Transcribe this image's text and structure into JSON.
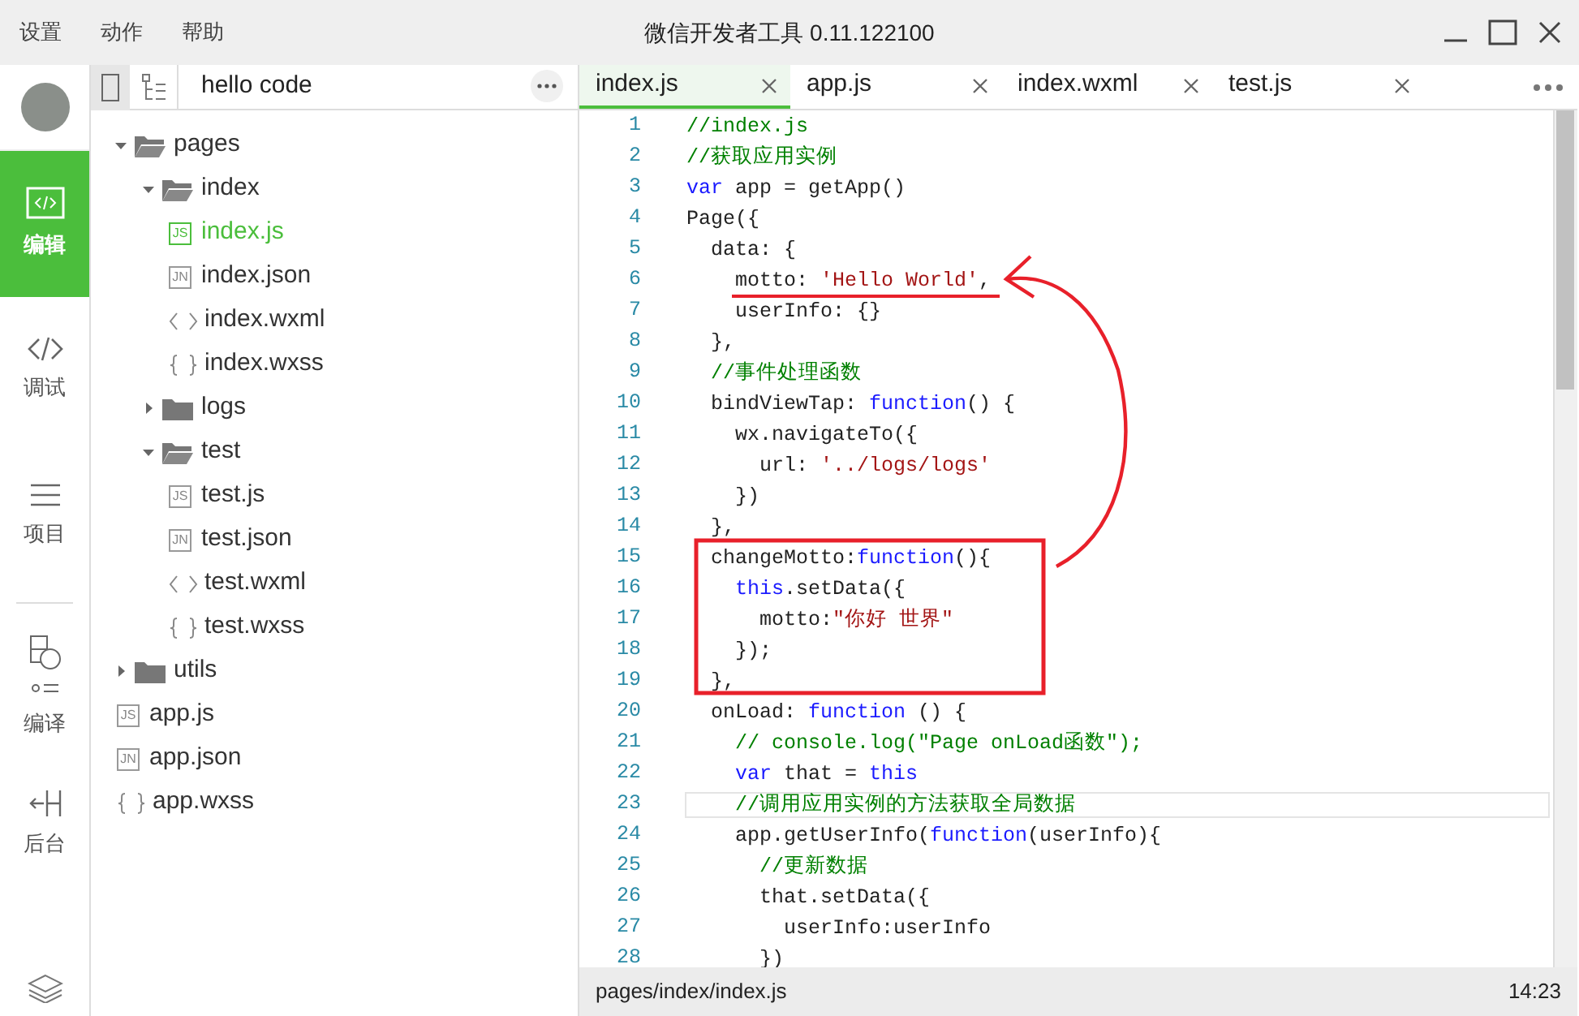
{
  "menu": [
    {
      "label": "设置"
    },
    {
      "label": "动作"
    },
    {
      "label": "帮助"
    }
  ],
  "window": {
    "title": "微信开发者工具 0.11.122100"
  },
  "nav": [
    {
      "label": "编辑",
      "kind": "edit",
      "selected": true
    },
    {
      "label": "调试",
      "kind": "debug",
      "selected": false
    },
    {
      "label": "项目",
      "kind": "project",
      "selected": false
    },
    {
      "label": "编译",
      "kind": "compile",
      "selected": false
    },
    {
      "label": "后台",
      "kind": "backend",
      "selected": false
    }
  ],
  "project": {
    "name": "hello code"
  },
  "tree": [
    {
      "name": "pages",
      "kind": "folder",
      "expanded": true,
      "children": [
        {
          "name": "index",
          "kind": "folder",
          "expanded": true,
          "children": [
            {
              "name": "index.js",
              "kind": "js",
              "badge": "JS",
              "selected": true
            },
            {
              "name": "index.json",
              "kind": "json",
              "badge": "JN",
              "selected": false
            },
            {
              "name": "index.wxml",
              "kind": "wxml",
              "selected": false
            },
            {
              "name": "index.wxss",
              "kind": "wxss",
              "selected": false
            }
          ]
        },
        {
          "name": "logs",
          "kind": "folder",
          "expanded": false
        },
        {
          "name": "test",
          "kind": "folder",
          "expanded": true,
          "children": [
            {
              "name": "test.js",
              "kind": "js",
              "badge": "JS",
              "selected": false
            },
            {
              "name": "test.json",
              "kind": "json",
              "badge": "JN",
              "selected": false
            },
            {
              "name": "test.wxml",
              "kind": "wxml",
              "selected": false
            },
            {
              "name": "test.wxss",
              "kind": "wxss",
              "selected": false
            }
          ]
        }
      ]
    },
    {
      "name": "utils",
      "kind": "folder",
      "expanded": false
    },
    {
      "name": "app.js",
      "kind": "js",
      "badge": "JS",
      "selected": false
    },
    {
      "name": "app.json",
      "kind": "json",
      "badge": "JN",
      "selected": false
    },
    {
      "name": "app.wxss",
      "kind": "wxss",
      "selected": false
    }
  ],
  "tabs": [
    {
      "label": "index.js",
      "selected": true
    },
    {
      "label": "app.js",
      "selected": false
    },
    {
      "label": "index.wxml",
      "selected": false
    },
    {
      "label": "test.js",
      "selected": false
    }
  ],
  "code": [
    {
      "n": "1",
      "current": false,
      "tokens": [
        {
          "kind": "comment",
          "text": "//index.js"
        }
      ]
    },
    {
      "n": "2",
      "current": false,
      "tokens": [
        {
          "kind": "comment",
          "text": "//获取应用实例"
        }
      ]
    },
    {
      "n": "3",
      "current": false,
      "tokens": [
        {
          "kind": "keyword",
          "text": "var"
        },
        {
          "kind": "plain",
          "text": " app = getApp()"
        }
      ]
    },
    {
      "n": "4",
      "current": false,
      "tokens": [
        {
          "kind": "plain",
          "text": "Page({"
        }
      ]
    },
    {
      "n": "5",
      "current": false,
      "tokens": [
        {
          "kind": "plain",
          "text": "  data: {"
        }
      ]
    },
    {
      "n": "6",
      "current": false,
      "tokens": [
        {
          "kind": "plain",
          "text": "    motto: "
        },
        {
          "kind": "string",
          "text": "'Hello World'"
        },
        {
          "kind": "plain",
          "text": ","
        }
      ]
    },
    {
      "n": "7",
      "current": false,
      "tokens": [
        {
          "kind": "plain",
          "text": "    userInfo: {}"
        }
      ]
    },
    {
      "n": "8",
      "current": false,
      "tokens": [
        {
          "kind": "plain",
          "text": "  },"
        }
      ]
    },
    {
      "n": "9",
      "current": false,
      "tokens": [
        {
          "kind": "comment",
          "text": "  //事件处理函数"
        }
      ]
    },
    {
      "n": "10",
      "current": false,
      "tokens": [
        {
          "kind": "plain",
          "text": "  bindViewTap: "
        },
        {
          "kind": "keyword",
          "text": "function"
        },
        {
          "kind": "plain",
          "text": "() {"
        }
      ]
    },
    {
      "n": "11",
      "current": false,
      "tokens": [
        {
          "kind": "plain",
          "text": "    wx.navigateTo({"
        }
      ]
    },
    {
      "n": "12",
      "current": false,
      "tokens": [
        {
          "kind": "plain",
          "text": "      url: "
        },
        {
          "kind": "string",
          "text": "'../logs/logs'"
        }
      ]
    },
    {
      "n": "13",
      "current": false,
      "tokens": [
        {
          "kind": "plain",
          "text": "    })"
        }
      ]
    },
    {
      "n": "14",
      "current": false,
      "tokens": [
        {
          "kind": "plain",
          "text": "  },"
        }
      ]
    },
    {
      "n": "15",
      "current": false,
      "tokens": [
        {
          "kind": "plain",
          "text": "  changeMotto:"
        },
        {
          "kind": "keyword",
          "text": "function"
        },
        {
          "kind": "plain",
          "text": "(){"
        }
      ]
    },
    {
      "n": "16",
      "current": false,
      "tokens": [
        {
          "kind": "keyword",
          "text": "    this"
        },
        {
          "kind": "plain",
          "text": ".setData({"
        }
      ]
    },
    {
      "n": "17",
      "current": false,
      "tokens": [
        {
          "kind": "plain",
          "text": "      motto:"
        },
        {
          "kind": "string",
          "text": "\"你好 世界\""
        }
      ]
    },
    {
      "n": "18",
      "current": false,
      "tokens": [
        {
          "kind": "plain",
          "text": "    });"
        }
      ]
    },
    {
      "n": "19",
      "current": false,
      "tokens": [
        {
          "kind": "plain",
          "text": "  },"
        }
      ]
    },
    {
      "n": "20",
      "current": false,
      "tokens": [
        {
          "kind": "plain",
          "text": "  onLoad: "
        },
        {
          "kind": "keyword",
          "text": "function"
        },
        {
          "kind": "plain",
          "text": " () {"
        }
      ]
    },
    {
      "n": "21",
      "current": false,
      "tokens": [
        {
          "kind": "comment",
          "text": "    // console.log(\"Page onLoad函数\");"
        }
      ]
    },
    {
      "n": "22",
      "current": false,
      "tokens": [
        {
          "kind": "keyword",
          "text": "    var"
        },
        {
          "kind": "plain",
          "text": " that = "
        },
        {
          "kind": "keyword",
          "text": "this"
        }
      ]
    },
    {
      "n": "23",
      "current": true,
      "tokens": [
        {
          "kind": "comment",
          "text": "    //调用应用实例的方法获取全局数据"
        }
      ]
    },
    {
      "n": "24",
      "current": false,
      "tokens": [
        {
          "kind": "plain",
          "text": "    app.getUserInfo("
        },
        {
          "kind": "keyword",
          "text": "function"
        },
        {
          "kind": "plain",
          "text": "(userInfo){"
        }
      ]
    },
    {
      "n": "25",
      "current": false,
      "tokens": [
        {
          "kind": "comment",
          "text": "      //更新数据"
        }
      ]
    },
    {
      "n": "26",
      "current": false,
      "tokens": [
        {
          "kind": "plain",
          "text": "      that.setData({"
        }
      ]
    },
    {
      "n": "27",
      "current": false,
      "tokens": [
        {
          "kind": "plain",
          "text": "        userInfo:userInfo"
        }
      ]
    },
    {
      "n": "28",
      "current": false,
      "tokens": [
        {
          "kind": "plain",
          "text": "      })"
        }
      ]
    }
  ],
  "status_bar": {
    "path": "pages/index/index.js",
    "time": "14:23"
  }
}
